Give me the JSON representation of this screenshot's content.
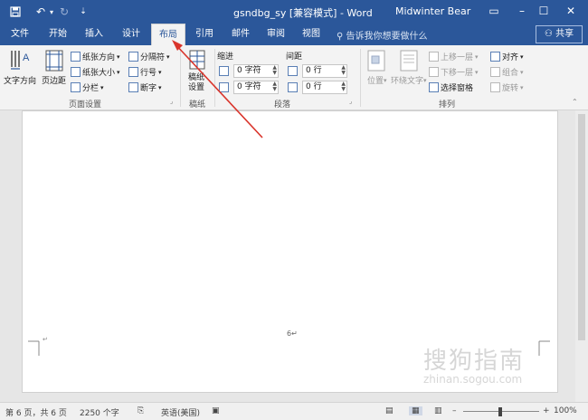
{
  "title_bar": {
    "doc_title": "gsndbg_sy [兼容模式] - Word",
    "user": "Midwinter Bear",
    "save_icon": "save-icon",
    "undo_icon": "undo-icon",
    "redo_icon": "redo-icon",
    "customize_icon": "customize-icon",
    "ribbon_display_icon": "ribbon-display-options-icon",
    "min_icon": "minimize-icon",
    "max_icon": "maximize-icon",
    "close_icon": "close-icon"
  },
  "tabs": [
    {
      "label": "文件"
    },
    {
      "label": "开始"
    },
    {
      "label": "插入"
    },
    {
      "label": "设计"
    },
    {
      "label": "布局"
    },
    {
      "label": "引用"
    },
    {
      "label": "邮件"
    },
    {
      "label": "审阅"
    },
    {
      "label": "视图"
    }
  ],
  "tell_me": "告诉我你想要做什么",
  "share": "共享",
  "ribbon": {
    "page_setup": {
      "text_direction": "文字方向",
      "margins": "页边距",
      "orientation": "纸张方向",
      "size": "纸张大小",
      "columns": "分栏",
      "breaks": "分隔符",
      "line_numbers": "行号",
      "hyphenation": "断字",
      "group_label": "页面设置"
    },
    "draft": {
      "btn_line1": "稿纸",
      "btn_line2": "设置",
      "group_label": "稿纸"
    },
    "paragraph": {
      "indent_label": "缩进",
      "spacing_label": "间距",
      "indent_left": "0 字符",
      "indent_right": "0 字符",
      "space_before": "0 行",
      "space_after": "0 行",
      "group_label": "段落"
    },
    "arrange": {
      "position": "位置",
      "wrap_text": "环绕文字",
      "bring_forward": "上移一层",
      "send_backward": "下移一层",
      "selection_pane": "选择窗格",
      "align": "对齐",
      "group": "组合",
      "rotate": "旋转",
      "group_label": "排列"
    }
  },
  "document": {
    "page_number": "6↵"
  },
  "status_bar": {
    "page_info": "第 6 页，共 6 页",
    "word_count": "2250 个字",
    "language": "英语(美国)",
    "zoom": "100%"
  },
  "watermark": {
    "main": "搜狗指南",
    "sub": "zhinan.sogou.com"
  },
  "colors": {
    "accent": "#2b579a",
    "ribbon_bg": "#f3f3f3",
    "annotation_arrow": "#d9342b"
  }
}
